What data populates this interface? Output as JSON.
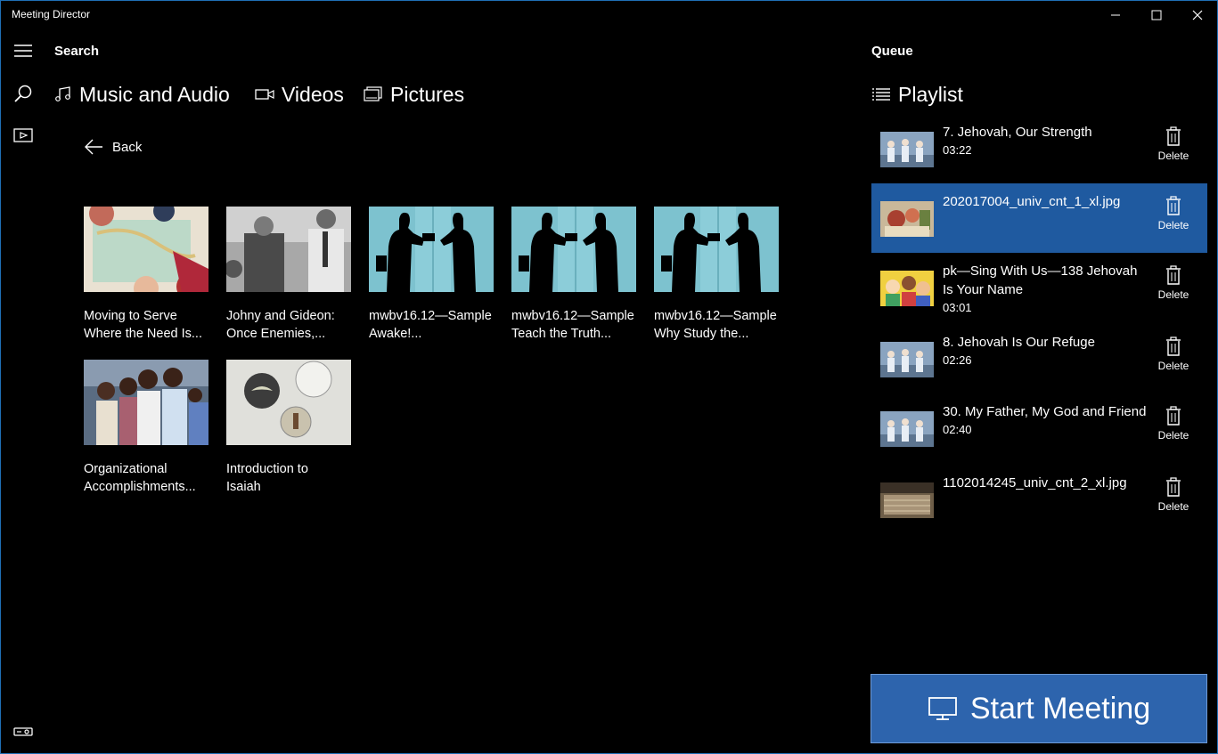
{
  "window": {
    "title": "Meeting Director"
  },
  "left": {
    "section_title": "Search",
    "tabs": [
      {
        "label": "Music and Audio",
        "icon": "music-note-icon"
      },
      {
        "label": "Videos",
        "icon": "video-camera-icon"
      },
      {
        "label": "Pictures",
        "icon": "pictures-icon"
      }
    ],
    "back_label": "Back",
    "media": [
      {
        "caption": "Moving to Serve\nWhere the Need Is..."
      },
      {
        "caption": "Johny and Gideon:\nOnce Enemies,..."
      },
      {
        "caption": "mwbv16.12—Sample\nAwake!..."
      },
      {
        "caption": "mwbv16.12—Sample\nTeach the Truth..."
      },
      {
        "caption": "mwbv16.12—Sample\nWhy Study the..."
      },
      {
        "caption": "Organizational\nAccomplishments..."
      },
      {
        "caption": "Introduction to\nIsaiah"
      }
    ]
  },
  "queue": {
    "title": "Queue",
    "playlist_label": "Playlist",
    "delete_label": "Delete",
    "items": [
      {
        "title": "7. Jehovah, Our Strength",
        "duration": "03:22",
        "selected": false
      },
      {
        "title": "202017004_univ_cnt_1_xl.jpg",
        "duration": "",
        "selected": true
      },
      {
        "title": "pk—Sing With Us—138 Jehovah Is Your Name",
        "duration": "03:01",
        "selected": false
      },
      {
        "title": "8. Jehovah Is Our Refuge",
        "duration": "02:26",
        "selected": false
      },
      {
        "title": "30. My Father, My God and Friend",
        "duration": "02:40",
        "selected": false
      },
      {
        "title": "1102014245_univ_cnt_2_xl.jpg",
        "duration": "",
        "selected": false
      }
    ]
  },
  "start_button": {
    "label": "Start Meeting"
  },
  "colors": {
    "accent": "#1f5aa0",
    "start_button": "#2d64ad",
    "background": "#000000"
  }
}
